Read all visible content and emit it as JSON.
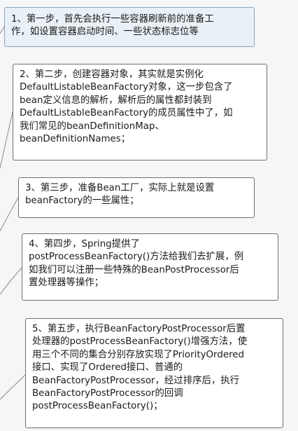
{
  "steps": [
    {
      "lines": [
        "1、第一步，首先会执行一些容器刷新前的准备工",
        "作，如设置容器启动时间、一些状态标志位等"
      ]
    },
    {
      "lines": [
        "2、第二步，创建容器对象，其实就是实例化",
        "DefaultListableBeanFactory对象，这一步包含了",
        "bean定义信息的解析，解析后的属性都封装到",
        "DefaultListableBeanFactory的成员属性中了，如",
        "我们常见的beanDefinitionMap、",
        "beanDefinitionNames；"
      ]
    },
    {
      "lines": [
        "3、第三步，准备Bean工厂，实际上就是设置",
        "beanFactory的一些属性；"
      ]
    },
    {
      "lines": [
        "4、第四步，Spring提供了",
        "postProcessBeanFactory()方法给我们去扩展，例",
        "如我们可以注册一些特殊的BeanPostProcessor后",
        "置处理器等操作；"
      ]
    },
    {
      "lines": [
        "5、第五步，执行BeanFactoryPostProcessor后置",
        "处理器的postProcessBeanFactory()增强方法，使",
        "用三个不同的集合分别存放实现了PriorityOrdered",
        "接口、实现了Ordered接口、普通的",
        "BeanFactoryPostProcessor，经过排序后，执行",
        "BeanFactoryPostProcessor的回调",
        "postProcessBeanFactory()；"
      ]
    }
  ]
}
